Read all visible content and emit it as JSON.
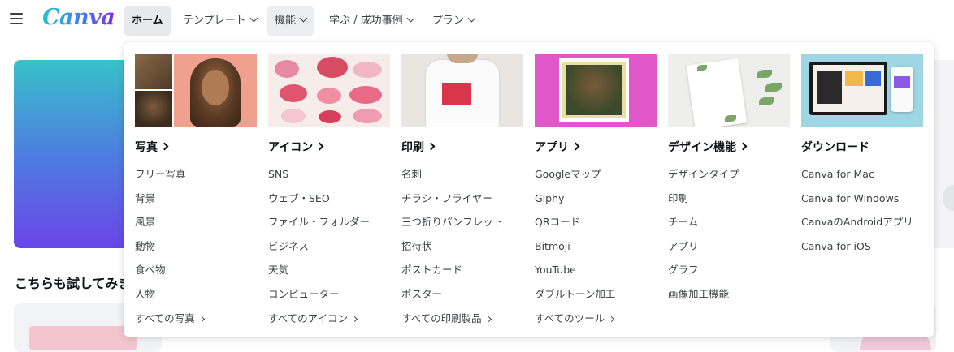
{
  "header": {
    "logo_text": "Canva",
    "nav": [
      {
        "label": "ホーム",
        "state": "active"
      },
      {
        "label": "テンプレート",
        "state": "default"
      },
      {
        "label": "機能",
        "state": "open"
      },
      {
        "label": "学ぶ / 成功事例",
        "state": "default"
      },
      {
        "label": "プラン",
        "state": "default"
      }
    ]
  },
  "background": {
    "section_title": "こちらも試してみま"
  },
  "dropdown": {
    "columns": [
      {
        "title": "写真",
        "image": "photos-thumbnail",
        "links": [
          "フリー写真",
          "背景",
          "風景",
          "動物",
          "食べ物",
          "人物",
          "すべての写真"
        ]
      },
      {
        "title": "アイコン",
        "image": "icons-thumbnail",
        "links": [
          "SNS",
          "ウェブ・SEO",
          "ファイル・フォルダー",
          "ビジネス",
          "天気",
          "コンピューター",
          "すべてのアイコン"
        ]
      },
      {
        "title": "印刷",
        "image": "print-thumbnail",
        "links": [
          "名刺",
          "チラシ・フライヤー",
          "三つ折りパンフレット",
          "招待状",
          "ポストカード",
          "ポスター",
          "すべての印刷製品"
        ]
      },
      {
        "title": "アプリ",
        "image": "apps-thumbnail",
        "links": [
          "Googleマップ",
          "Giphy",
          "QRコード",
          "Bitmoji",
          "YouTube",
          "ダブルトーン加工",
          "すべてのツール"
        ]
      },
      {
        "title": "デザイン機能",
        "image": "design-features-thumbnail",
        "links": [
          "デザインタイプ",
          "印刷",
          "チーム",
          "アプリ",
          "グラフ",
          "画像加工機能"
        ]
      },
      {
        "title": "ダウンロード",
        "image": "download-thumbnail",
        "links": [
          "Canva for Mac",
          "Canva for Windows",
          "CanvaのAndroidアプリ",
          "Canva for iOS"
        ]
      }
    ]
  },
  "colors": {
    "brand_gradient_start": "#20c4cb",
    "brand_gradient_end": "#7d2ae8",
    "text": "#0e1318",
    "link": "#3d4145",
    "active_tab_bg": "#e8e9ea"
  }
}
